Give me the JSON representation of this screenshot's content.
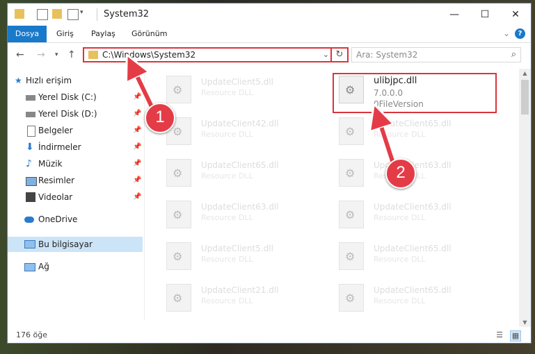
{
  "window": {
    "title": "System32",
    "controls": {
      "minimize": "—",
      "maximize": "☐",
      "close": "✕"
    }
  },
  "ribbon": {
    "tabs": [
      "Dosya",
      "Giriş",
      "Paylaş",
      "Görünüm"
    ],
    "help": "?"
  },
  "nav": {
    "address_path": "C:\\Windows\\System32",
    "search_placeholder": "Ara: System32"
  },
  "sidebar": {
    "items": [
      {
        "label": "Hızlı erişim",
        "icon": "star-icon"
      },
      {
        "label": "Yerel Disk (C:)",
        "icon": "drive-icon",
        "pinned": true
      },
      {
        "label": "Yerel Disk (D:)",
        "icon": "drive-icon",
        "pinned": true
      },
      {
        "label": "Belgeler",
        "icon": "documents-icon",
        "pinned": true
      },
      {
        "label": "İndirmeler",
        "icon": "download-icon",
        "pinned": true
      },
      {
        "label": "Müzik",
        "icon": "music-icon",
        "pinned": true
      },
      {
        "label": "Resimler",
        "icon": "pictures-icon",
        "pinned": true
      },
      {
        "label": "Videolar",
        "icon": "videos-icon",
        "pinned": true
      },
      {
        "label": "OneDrive",
        "icon": "cloud-icon"
      },
      {
        "label": "Bu bilgisayar",
        "icon": "computer-icon",
        "selected": true
      },
      {
        "label": "Ağ",
        "icon": "network-icon"
      }
    ]
  },
  "files": {
    "left_column": [
      {
        "name": "UpdateClient5.dll",
        "desc": "Resource DLL"
      },
      {
        "name": "UpdateClient42.dll",
        "desc": "Resource DLL"
      },
      {
        "name": "UpdateClient65.dll",
        "desc": "Resource DLL"
      },
      {
        "name": "UpdateClient63.dll",
        "desc": "Resource DLL"
      },
      {
        "name": "UpdateClient5.dll",
        "desc": "Resource DLL"
      },
      {
        "name": "UpdateClient21.dll",
        "desc": "Resource DLL"
      }
    ],
    "selected": {
      "name": "ulibjpc.dll",
      "version": "7.0.0.0",
      "file_version": "0FileVersion"
    },
    "right_column": [
      {
        "name": "UpdateClient65.dll",
        "desc": "Resource DLL"
      },
      {
        "name": "UpdateClient63.dll",
        "desc": "Resource DLL"
      },
      {
        "name": "UpdateClient63.dll",
        "desc": "Resource DLL"
      },
      {
        "name": "UpdateClient65.dll",
        "desc": "Resource DLL"
      },
      {
        "name": "UpdateClient65.dll",
        "desc": "Resource DLL"
      }
    ]
  },
  "status": {
    "item_count": "176 öğe"
  },
  "annotations": {
    "step1": "1",
    "step2": "2",
    "accent": "#e43c47"
  }
}
